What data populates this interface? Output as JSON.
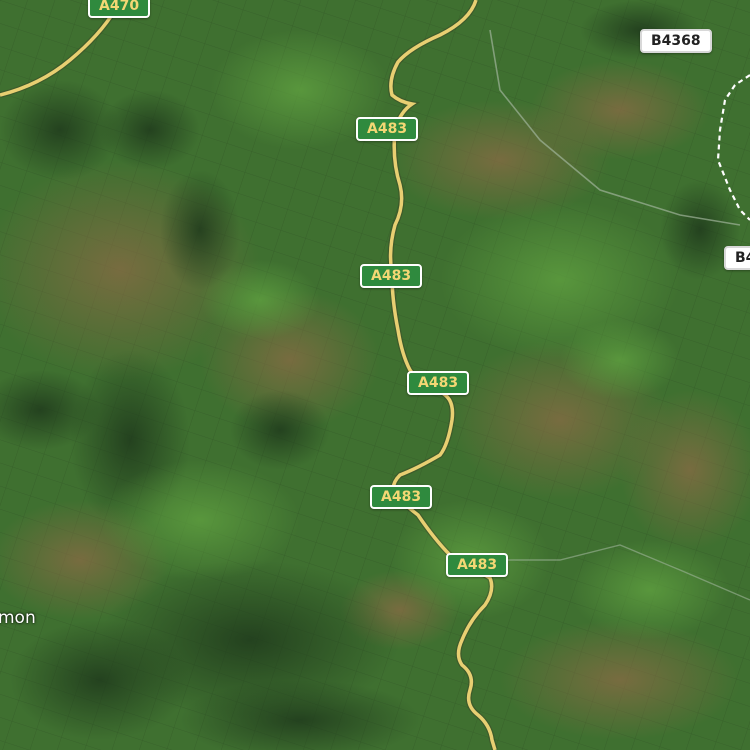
{
  "map": {
    "type": "satellite",
    "colors": {
      "primary_road": "#e8cf72",
      "primary_shield_bg": "#2f8a3e",
      "primary_shield_text": "#f3d774",
      "b_road_shield_bg": "#ffffff",
      "border_line": "#ffffff"
    },
    "road_labels": {
      "a470": "A470",
      "a483_1": "A483",
      "a483_2": "A483",
      "a483_3": "A483",
      "a483_4": "A483",
      "a483_5": "A483",
      "b4368": "B4368",
      "b4_partial": "B4"
    },
    "place_labels": {
      "partial_town": "mon"
    }
  }
}
